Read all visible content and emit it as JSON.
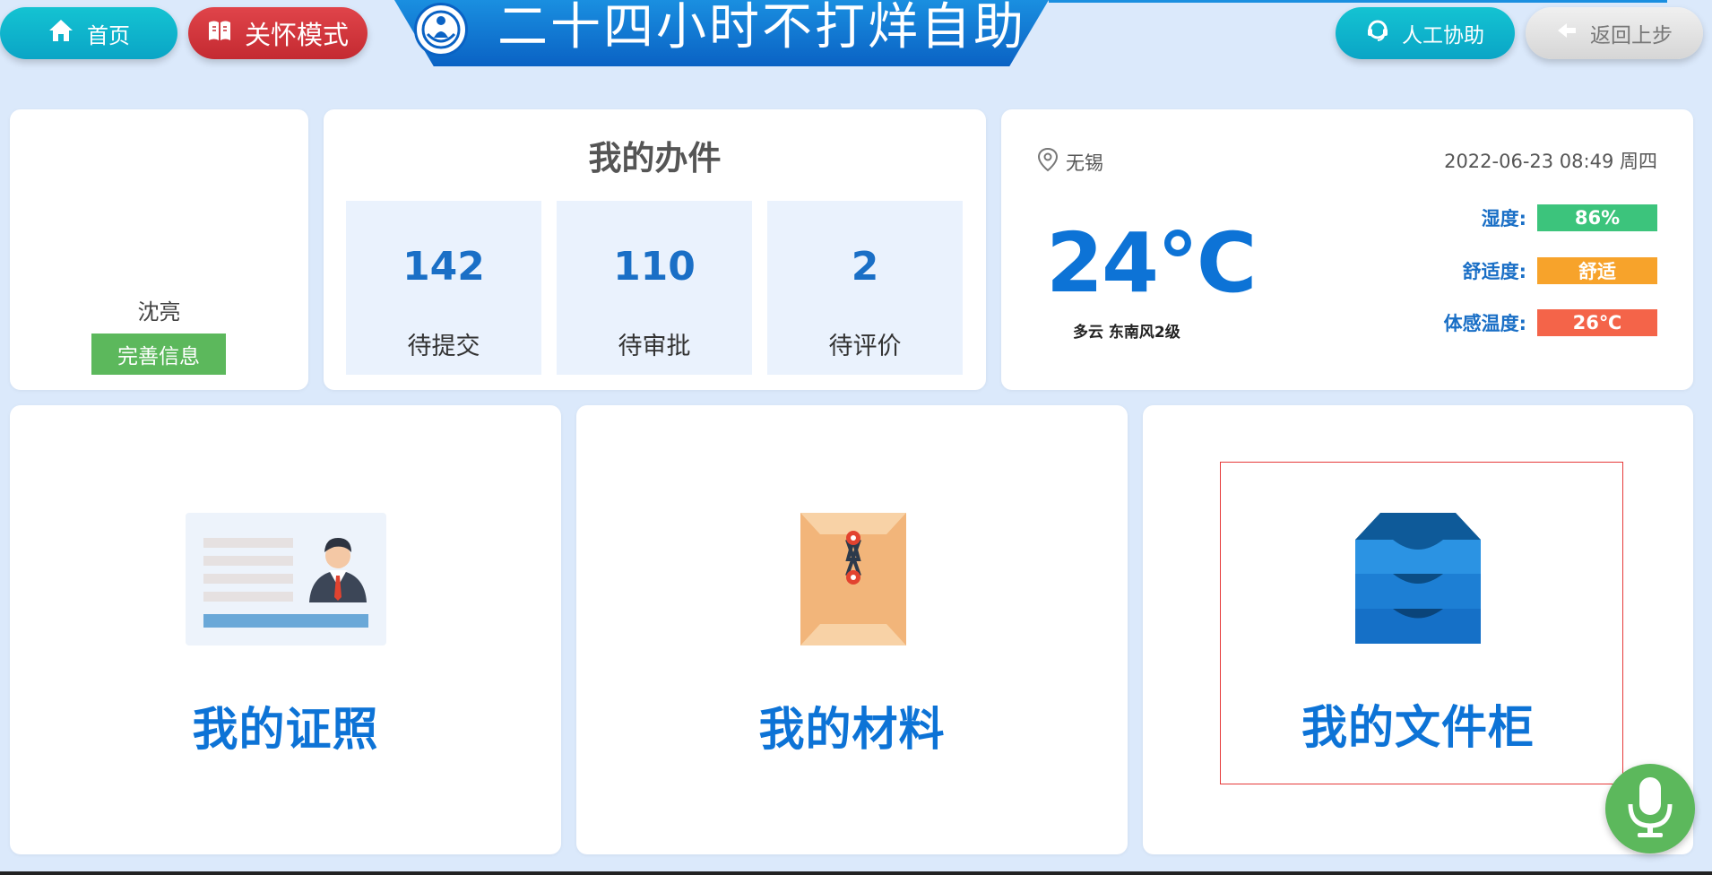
{
  "header": {
    "home_label": "首页",
    "care_mode_label": "关怀模式",
    "title": "二十四小时不打烊自助",
    "manual_help_label": "人工协助",
    "back_label": "返回上步"
  },
  "user": {
    "name": "沈亮",
    "complete_info_label": "完善信息"
  },
  "my_tasks": {
    "title": "我的办件",
    "items": [
      {
        "count": "142",
        "label": "待提交"
      },
      {
        "count": "110",
        "label": "待审批"
      },
      {
        "count": "2",
        "label": "待评价"
      }
    ]
  },
  "weather": {
    "location": "无锡",
    "datetime": "2022-06-23 08:49 周四",
    "temperature": "24℃",
    "description": "多云  东南风2级",
    "humidity_label": "湿度:",
    "humidity_value": "86%",
    "comfort_label": "舒适度:",
    "comfort_value": "舒适",
    "feels_like_label": "体感温度:",
    "feels_like_value": "26℃",
    "colors": {
      "humidity": "#3cc47c",
      "comfort": "#f7a32b",
      "feels_like": "#f46449"
    }
  },
  "tiles": [
    {
      "label": "我的证照",
      "icon": "id-card-icon"
    },
    {
      "label": "我的材料",
      "icon": "document-envelope-icon"
    },
    {
      "label": "我的文件柜",
      "icon": "file-cabinet-icon"
    }
  ],
  "voice": {
    "icon": "microphone-icon"
  }
}
